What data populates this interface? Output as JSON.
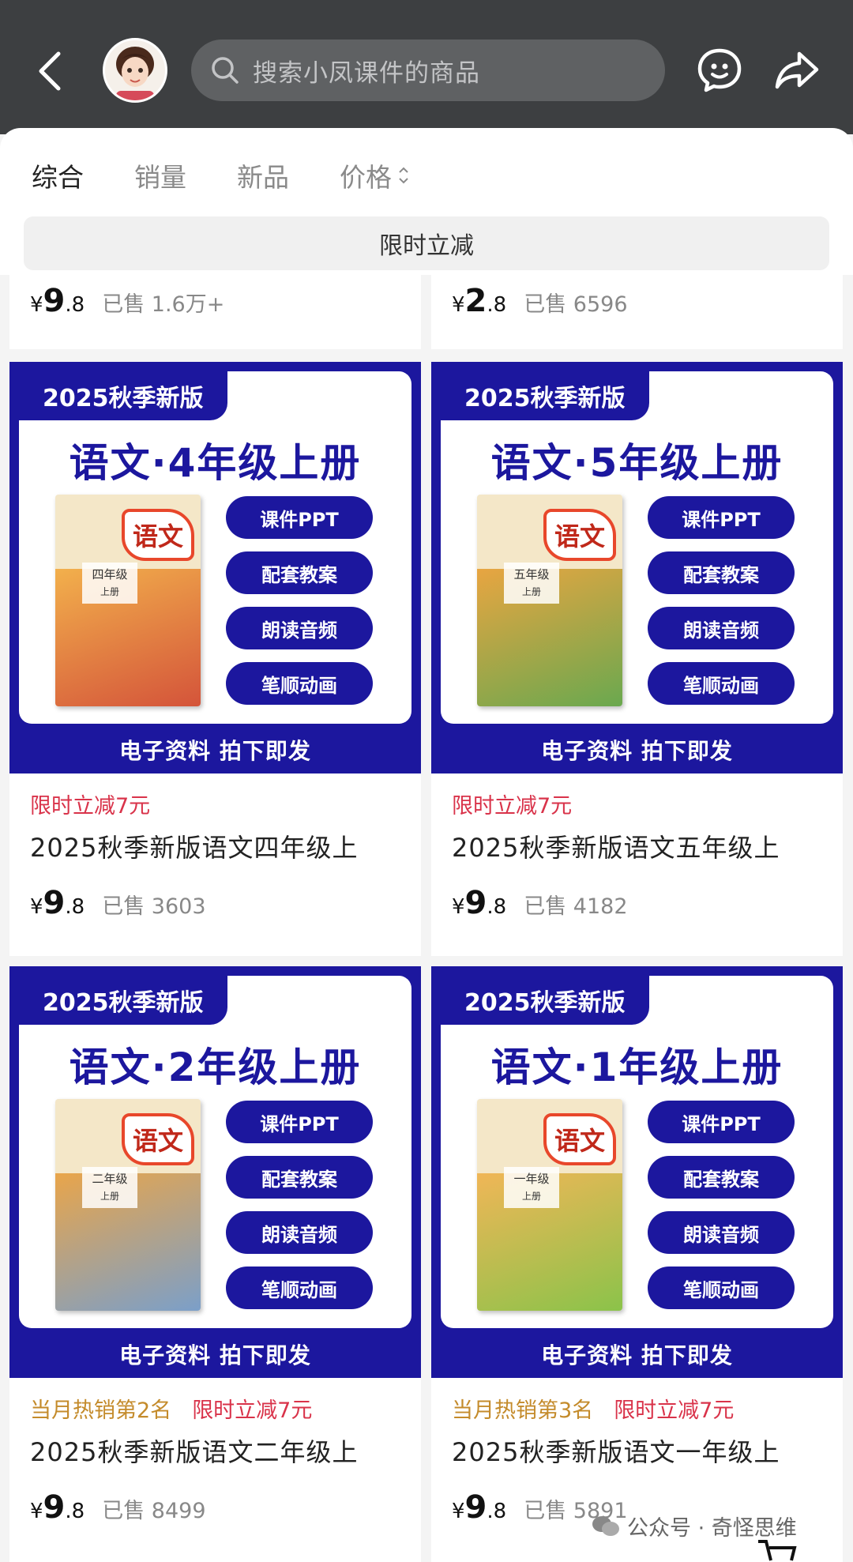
{
  "header": {
    "search_placeholder": "搜索小凤课件的商品",
    "colors": {
      "bar": "#3d3f41",
      "search_bg": "#5f6163"
    }
  },
  "sort_tabs": [
    {
      "label": "综合",
      "active": true
    },
    {
      "label": "销量",
      "active": false
    },
    {
      "label": "新品",
      "active": false
    },
    {
      "label": "价格",
      "active": false
    }
  ],
  "promo_filter": "限时立减",
  "top_partial": [
    {
      "yen": "¥",
      "int": "9",
      "dec": ".8",
      "sold": "已售 1.6万+"
    },
    {
      "yen": "¥",
      "int": "2",
      "dec": ".8",
      "sold": "已售 6596"
    }
  ],
  "products": [
    {
      "edition": "2025秋季新版",
      "poster_title": "语文·4年级上册",
      "book_chars": "语文",
      "book_grade": "四年级",
      "book_term": "上册",
      "features": [
        "课件PPT",
        "配套教案",
        "朗读音频",
        "笔顺动画"
      ],
      "footer": "电子资料 拍下即发",
      "hot_badge": "",
      "promo_badge": "限时立减7元",
      "title": "2025秋季新版语文四年级上",
      "yen": "¥",
      "int": "9",
      "dec": ".8",
      "sold": "已售 3603"
    },
    {
      "edition": "2025秋季新版",
      "poster_title": "语文·5年级上册",
      "book_chars": "语文",
      "book_grade": "五年级",
      "book_term": "上册",
      "features": [
        "课件PPT",
        "配套教案",
        "朗读音频",
        "笔顺动画"
      ],
      "footer": "电子资料 拍下即发",
      "hot_badge": "",
      "promo_badge": "限时立减7元",
      "title": "2025秋季新版语文五年级上",
      "yen": "¥",
      "int": "9",
      "dec": ".8",
      "sold": "已售 4182"
    },
    {
      "edition": "2025秋季新版",
      "poster_title": "语文·2年级上册",
      "book_chars": "语文",
      "book_grade": "二年级",
      "book_term": "上册",
      "features": [
        "课件PPT",
        "配套教案",
        "朗读音频",
        "笔顺动画"
      ],
      "footer": "电子资料 拍下即发",
      "hot_badge": "当月热销第2名",
      "promo_badge": "限时立减7元",
      "title": "2025秋季新版语文二年级上",
      "yen": "¥",
      "int": "9",
      "dec": ".8",
      "sold": "已售 8499"
    },
    {
      "edition": "2025秋季新版",
      "poster_title": "语文·1年级上册",
      "book_chars": "语文",
      "book_grade": "一年级",
      "book_term": "上册",
      "features": [
        "课件PPT",
        "配套教案",
        "朗读音频",
        "笔顺动画"
      ],
      "footer": "电子资料 拍下即发",
      "hot_badge": "当月热销第3名",
      "promo_badge": "限时立减7元",
      "title": "2025秋季新版语文一年级上",
      "yen": "¥",
      "int": "9",
      "dec": ".8",
      "sold": "已售 5891"
    }
  ],
  "watermark": "公众号 · 奇怪思维",
  "colors": {
    "poster_blue": "#1c179e",
    "promo_red": "#d9334a",
    "hot_gold": "#c48b2b"
  },
  "icons": [
    "back-icon",
    "avatar",
    "search-icon",
    "chat-icon",
    "share-icon",
    "cart-icon"
  ]
}
